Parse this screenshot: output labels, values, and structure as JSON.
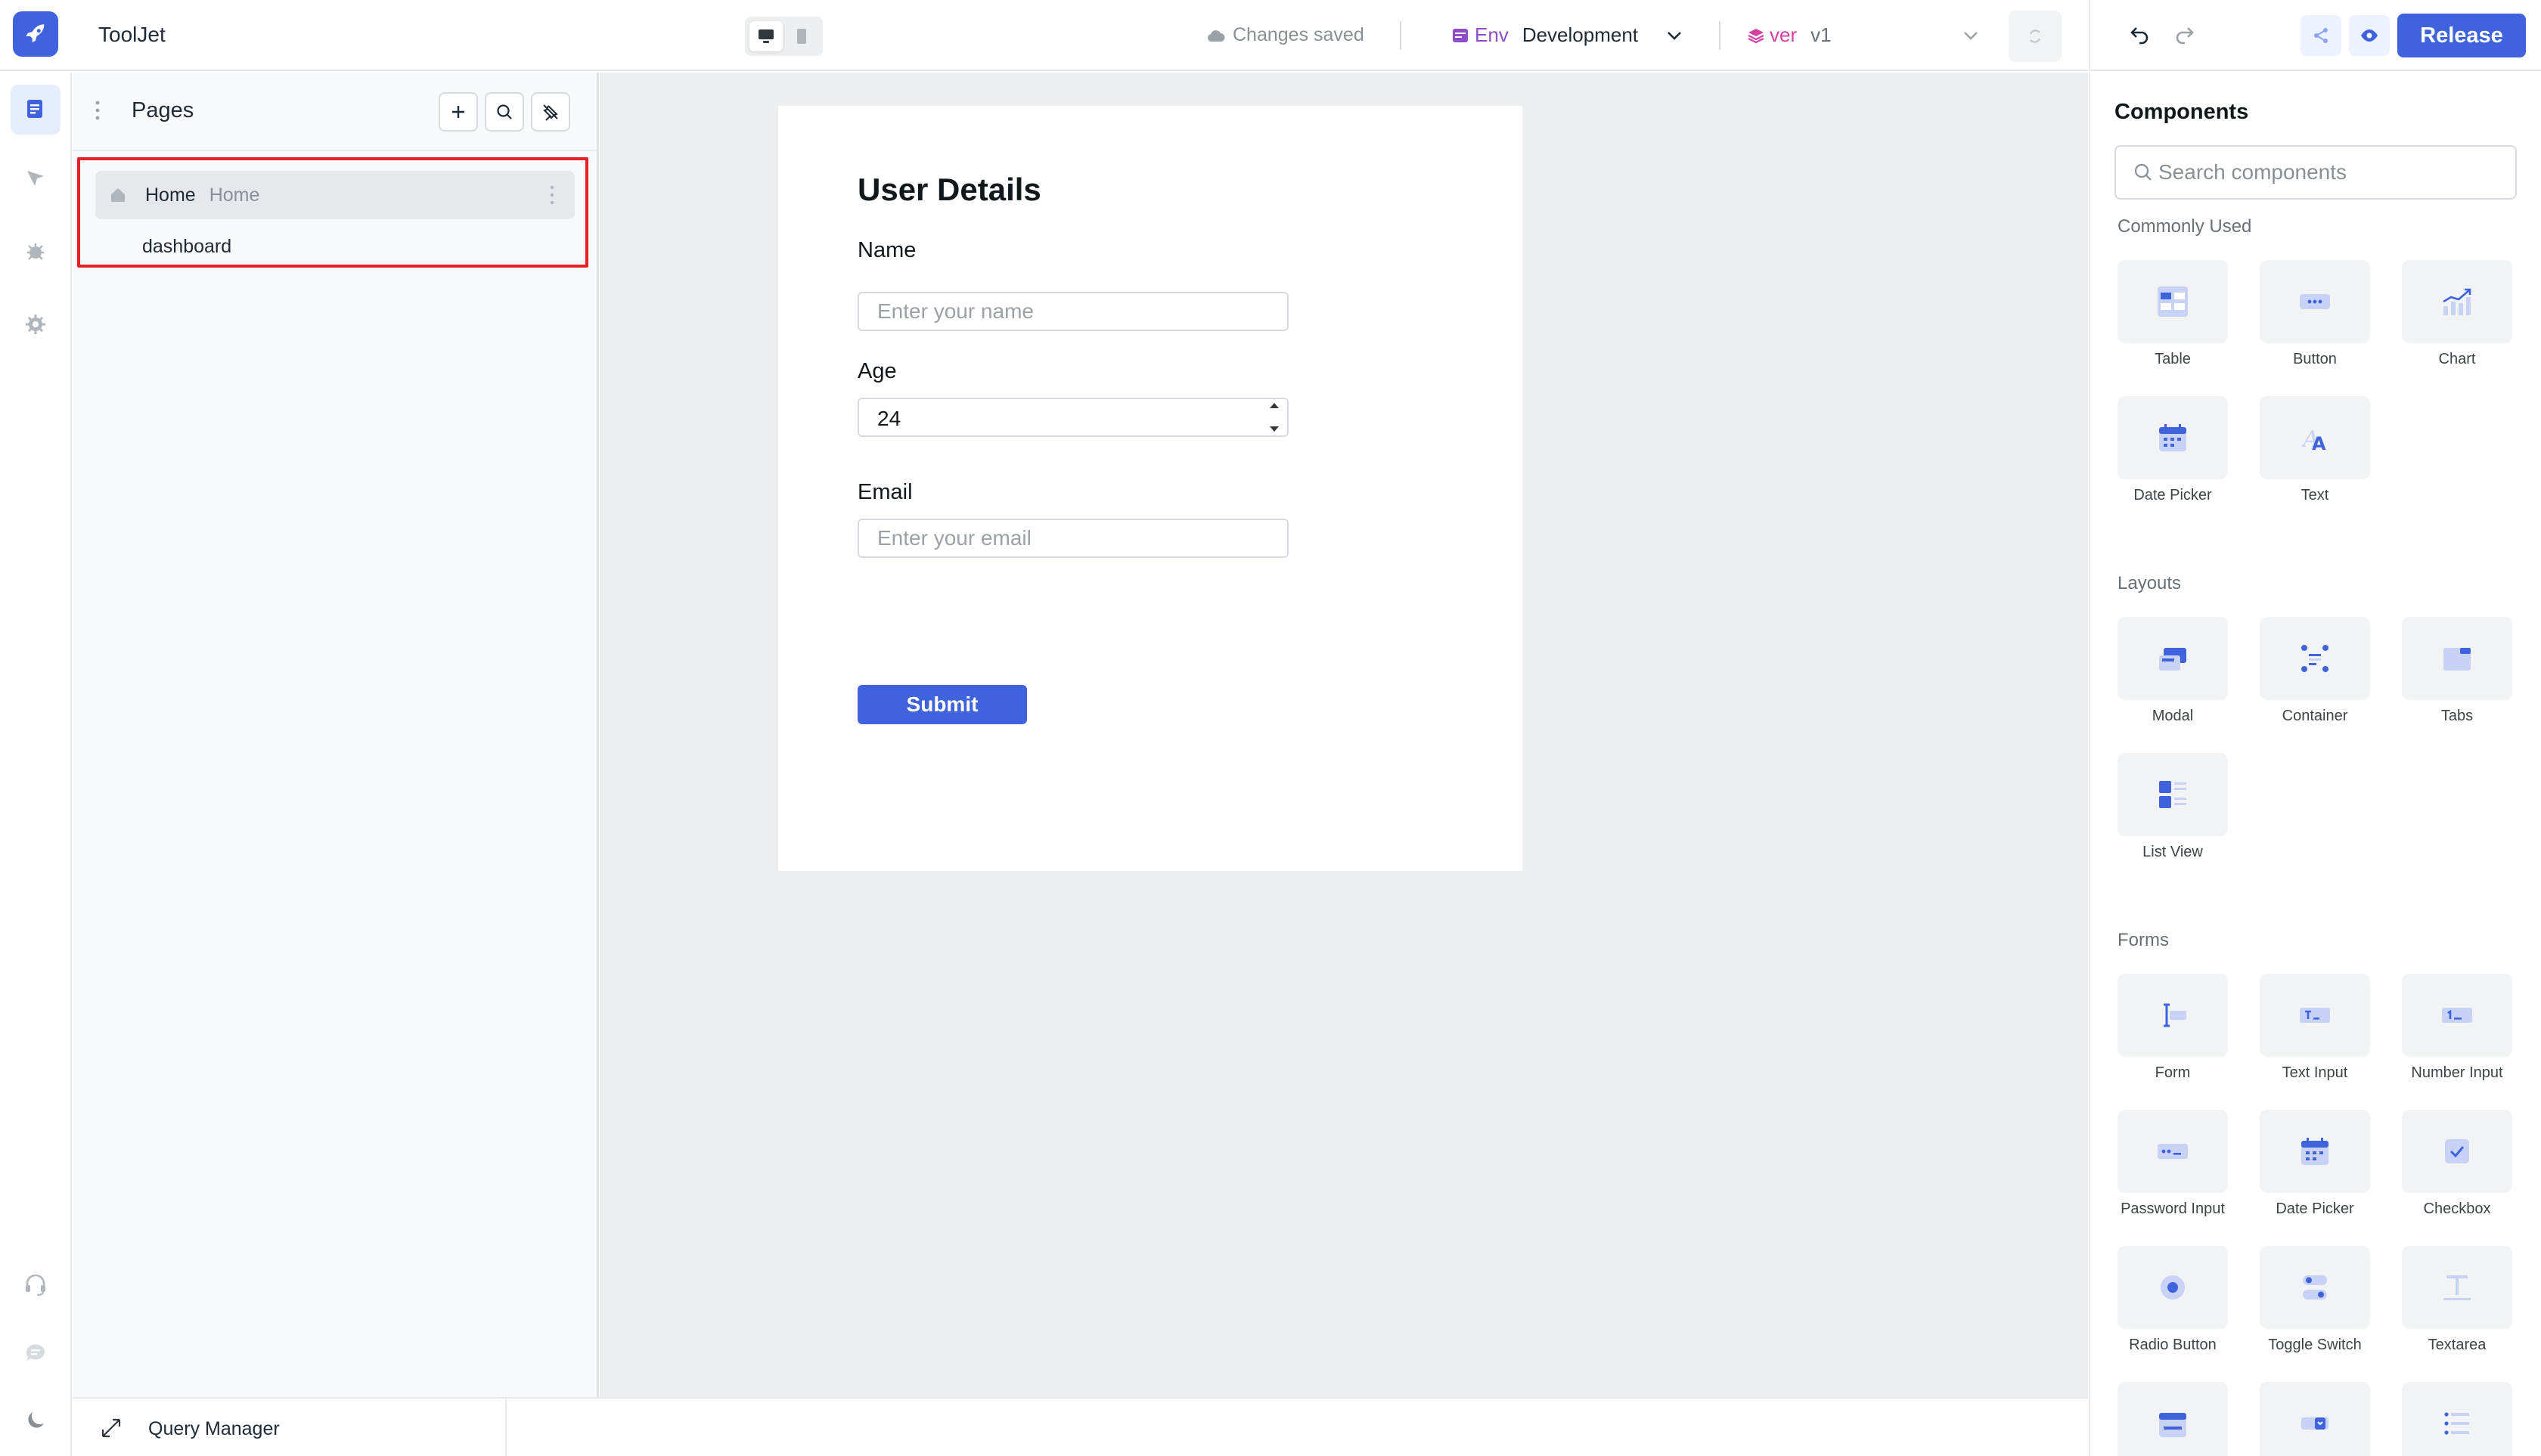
{
  "topbar": {
    "app_name": "ToolJet",
    "save_status": "Changes saved",
    "env_label": "Env",
    "env_value": "Development",
    "version_label": "ver",
    "version_value": "v1",
    "release_label": "Release"
  },
  "pages_panel": {
    "title": "Pages",
    "pages": [
      {
        "name": "Home",
        "handle": "Home",
        "is_home": true,
        "active": true
      },
      {
        "name": "dashboard",
        "handle": "",
        "is_home": false,
        "active": false
      }
    ]
  },
  "canvas": {
    "form": {
      "title": "User Details",
      "name_label": "Name",
      "name_placeholder": "Enter your name",
      "age_label": "Age",
      "age_value": "24",
      "email_label": "Email",
      "email_placeholder": "Enter your email",
      "submit_label": "Submit"
    }
  },
  "query_manager": {
    "title": "Query Manager"
  },
  "components_panel": {
    "title": "Components",
    "search_placeholder": "Search components",
    "sections": {
      "commonly_used": {
        "title": "Commonly Used",
        "items": [
          "Table",
          "Button",
          "Chart",
          "Date Picker",
          "Text"
        ]
      },
      "layouts": {
        "title": "Layouts",
        "items": [
          "Modal",
          "Container",
          "Tabs",
          "List View"
        ]
      },
      "forms": {
        "title": "Forms",
        "items": [
          "Form",
          "Text Input",
          "Number Input",
          "Password Input",
          "Date Picker",
          "Checkbox",
          "Radio Button",
          "Toggle Switch",
          "Textarea"
        ]
      }
    }
  },
  "colors": {
    "accent": "#3e63dd",
    "env": "#8e4ec6",
    "version": "#d6409f",
    "highlight": "#e5202b",
    "canvas_bg": "#eceef0"
  }
}
